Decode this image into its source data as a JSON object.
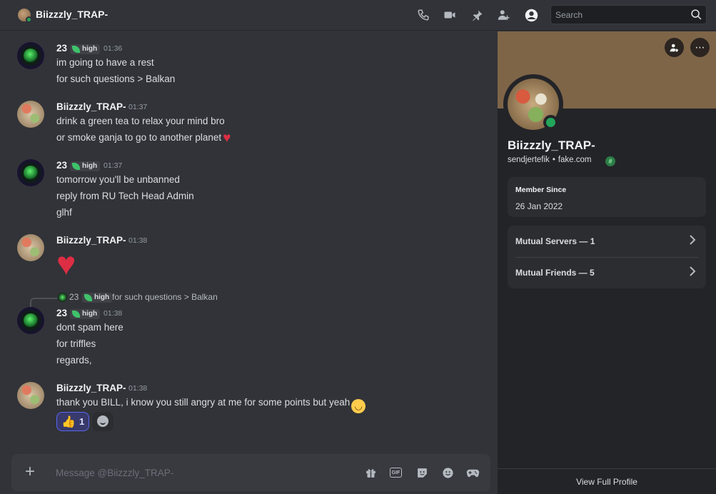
{
  "header": {
    "title": "Biizzzly_TRAP-",
    "icons": [
      "voice-call-icon",
      "video-call-icon",
      "pin-icon",
      "add-friends-icon",
      "user-profile-icon"
    ],
    "search_placeholder": "Search"
  },
  "messages": [
    {
      "author": "23",
      "tag": "high",
      "time": "01:36",
      "lines": [
        "im going to have a rest",
        "for such questions > Balkan"
      ]
    },
    {
      "author": "Biizzzly_TRAP-",
      "time": "01:37",
      "lines": [
        "drink a green tea to relax your mind bro",
        "or smoke ganja to go to another planet"
      ],
      "emoji": "heart"
    },
    {
      "author": "23",
      "tag": "high",
      "time": "01:37",
      "lines": [
        "tomorrow you'll be unbanned",
        "reply from RU Tech Head Admin",
        "glhf"
      ]
    },
    {
      "author": "Biizzzly_TRAP-",
      "time": "01:38",
      "big_emoji": "heart"
    },
    {
      "reply": {
        "author": "23",
        "tag": "high",
        "text": "for such questions > Balkan"
      },
      "author": "23",
      "tag": "high",
      "time": "01:38",
      "lines": [
        "dont spam here",
        "for triffles",
        "regards,"
      ]
    },
    {
      "author": "Biizzzly_TRAP-",
      "time": "01:38",
      "lines": [
        "thank you BILL, i know you still angry at me for some points but yeah"
      ],
      "emoji": "slightly-smiling-face",
      "reaction": {
        "emoji": "thumbs-up",
        "count": "1"
      }
    }
  ],
  "composer": {
    "placeholder": "Message @Biizzzly_TRAP-",
    "icons": [
      "gift-icon",
      "gif-icon",
      "sticker-icon",
      "emoji-icon",
      "activities-icon"
    ]
  },
  "profile": {
    "display_name": "Biizzzly_TRAP-",
    "username": "sendjertefik",
    "pronouns": "fake.com",
    "badge": "#",
    "member_since_label": "Member Since",
    "member_since_value": "26 Jan 2022",
    "mutual_servers": "Mutual Servers — 1",
    "mutual_friends": "Mutual Friends — 5",
    "view_full": "View Full Profile",
    "status_color": "#23a55a",
    "banner_color": "#7e6548"
  }
}
